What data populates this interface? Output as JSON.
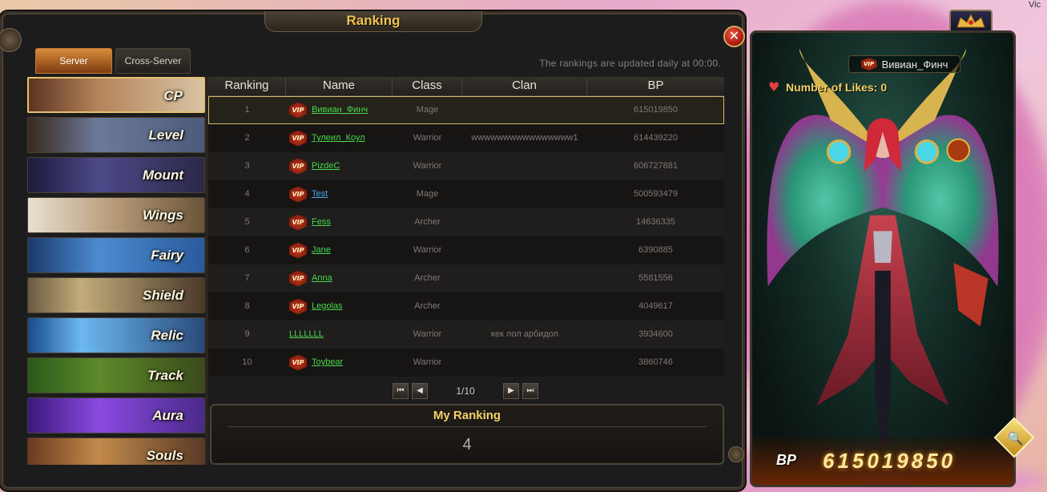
{
  "window": {
    "title": "Ranking",
    "close_symbol": "✕"
  },
  "tabs": {
    "server": "Server",
    "cross_server": "Cross-Server"
  },
  "update_note": "The rankings are updated daily at 00:00.",
  "categories": [
    {
      "label": "CP",
      "active": true
    },
    {
      "label": "Level"
    },
    {
      "label": "Mount"
    },
    {
      "label": "Wings"
    },
    {
      "label": "Fairy"
    },
    {
      "label": "Shield"
    },
    {
      "label": "Relic"
    },
    {
      "label": "Track"
    },
    {
      "label": "Aura"
    },
    {
      "label": "Souls"
    }
  ],
  "table": {
    "headers": {
      "ranking": "Ranking",
      "name": "Name",
      "class": "Class",
      "clan": "Clan",
      "bp": "BP"
    },
    "rows": [
      {
        "rank": "1",
        "vip": true,
        "name": "Вивиан_Финч",
        "name_color": "green",
        "class": "Mage",
        "clan": "",
        "bp": "615019850"
      },
      {
        "rank": "2",
        "vip": true,
        "name": "Тулеил_Коул",
        "name_color": "green",
        "class": "Warrior",
        "clan": "wwwwwwwwwwwwwwww1",
        "bp": "614439220"
      },
      {
        "rank": "3",
        "vip": true,
        "name": "PizdeC",
        "name_color": "green",
        "class": "Warrior",
        "clan": "",
        "bp": "606727881"
      },
      {
        "rank": "4",
        "vip": true,
        "name": "Test",
        "name_color": "blue",
        "class": "Mage",
        "clan": "",
        "bp": "500593479"
      },
      {
        "rank": "5",
        "vip": true,
        "name": "Fess",
        "name_color": "green",
        "class": "Archer",
        "clan": "",
        "bp": "14636335"
      },
      {
        "rank": "6",
        "vip": true,
        "name": "Jane",
        "name_color": "green",
        "class": "Warrior",
        "clan": "",
        "bp": "6390885"
      },
      {
        "rank": "7",
        "vip": true,
        "name": "Anna",
        "name_color": "green",
        "class": "Archer",
        "clan": "",
        "bp": "5581556"
      },
      {
        "rank": "8",
        "vip": true,
        "name": "Legolas",
        "name_color": "green",
        "class": "Archer",
        "clan": "",
        "bp": "4049617"
      },
      {
        "rank": "9",
        "vip": false,
        "name": "LLLLLLL",
        "name_color": "green",
        "class": "Warrior",
        "clan": "кек лол арбидол",
        "bp": "3934600"
      },
      {
        "rank": "10",
        "vip": true,
        "name": "Toybear",
        "name_color": "green",
        "class": "Warrior",
        "clan": "",
        "bp": "3860746"
      }
    ]
  },
  "vip_label": "VIP",
  "pager": {
    "first": "⏮",
    "prev": "◀",
    "page": "1/10",
    "next": "▶",
    "last": "⏭"
  },
  "my_ranking": {
    "title": "My Ranking",
    "value": "4"
  },
  "character": {
    "vip_label": "VIP",
    "name": "Вивиан_Финч",
    "likes_label": "Number of Likes:",
    "likes": "0",
    "bp_label": "BP",
    "bp_value": "615019850"
  },
  "background_text": "Vic",
  "colors": {
    "accent_gold": "#f3c54d",
    "name_green": "#47d84b",
    "name_blue": "#47a6ee",
    "close_red": "#c3241a"
  }
}
